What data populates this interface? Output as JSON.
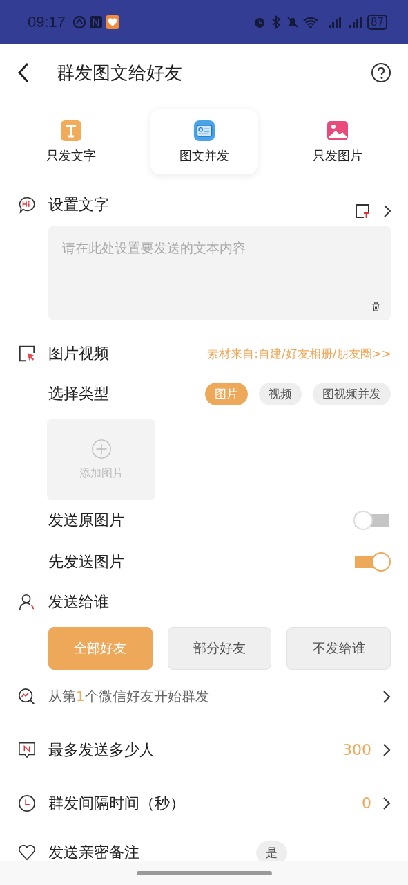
{
  "status_bar": {
    "time": "09:17",
    "battery": "87"
  },
  "header": {
    "title": "群发图文给好友"
  },
  "modes": [
    {
      "label": "只发文字",
      "kind": "text",
      "selected": false
    },
    {
      "label": "图文并发",
      "kind": "mixed",
      "selected": true
    },
    {
      "label": "只发图片",
      "kind": "image",
      "selected": false
    }
  ],
  "text_section": {
    "title": "设置文字",
    "placeholder": "请在此处设置要发送的文本内容"
  },
  "media_section": {
    "title": "图片视频",
    "source_link": "素材来自:自建/好友相册/朋友圈>>",
    "type_label": "选择类型",
    "types": [
      {
        "label": "图片",
        "selected": true
      },
      {
        "label": "视频",
        "selected": false
      },
      {
        "label": "图视频并发",
        "selected": false
      }
    ],
    "add_label": "添加图片",
    "toggles": [
      {
        "label": "发送原图片",
        "on": false
      },
      {
        "label": "先发送图片",
        "on": true
      }
    ]
  },
  "recipients": {
    "title": "发送给谁",
    "options": [
      {
        "label": "全部好友",
        "selected": true
      },
      {
        "label": "部分好友",
        "selected": false
      },
      {
        "label": "不发给谁",
        "selected": false
      }
    ]
  },
  "settings": [
    {
      "kind": "start",
      "prefix": "从第",
      "highlight": "1",
      "suffix": "个微信好友开始群发"
    },
    {
      "kind": "max",
      "label": "最多发送多少人",
      "value": "300"
    },
    {
      "kind": "interval",
      "label": "群发间隔时间（秒）",
      "value": "0"
    }
  ],
  "last_row": {
    "label": "发送亲密备注",
    "options": [
      {
        "label": "是",
        "selected": false
      }
    ]
  }
}
